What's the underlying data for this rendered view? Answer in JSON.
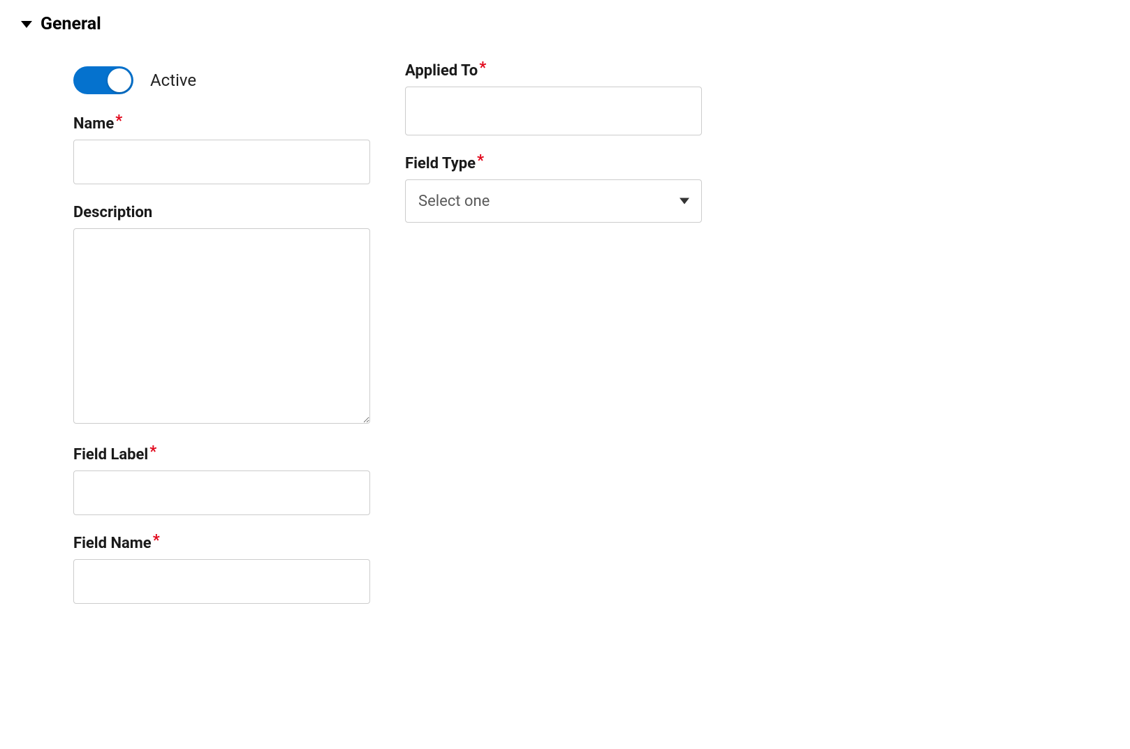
{
  "section": {
    "title": "General"
  },
  "toggle": {
    "label": "Active",
    "on": true
  },
  "left": {
    "name": {
      "label": "Name",
      "value": ""
    },
    "description": {
      "label": "Description",
      "value": ""
    },
    "fieldLabel": {
      "label": "Field Label",
      "value": ""
    },
    "fieldName": {
      "label": "Field Name",
      "value": ""
    }
  },
  "right": {
    "appliedTo": {
      "label": "Applied To",
      "value": ""
    },
    "fieldType": {
      "label": "Field Type",
      "placeholder": "Select one",
      "value": ""
    }
  }
}
